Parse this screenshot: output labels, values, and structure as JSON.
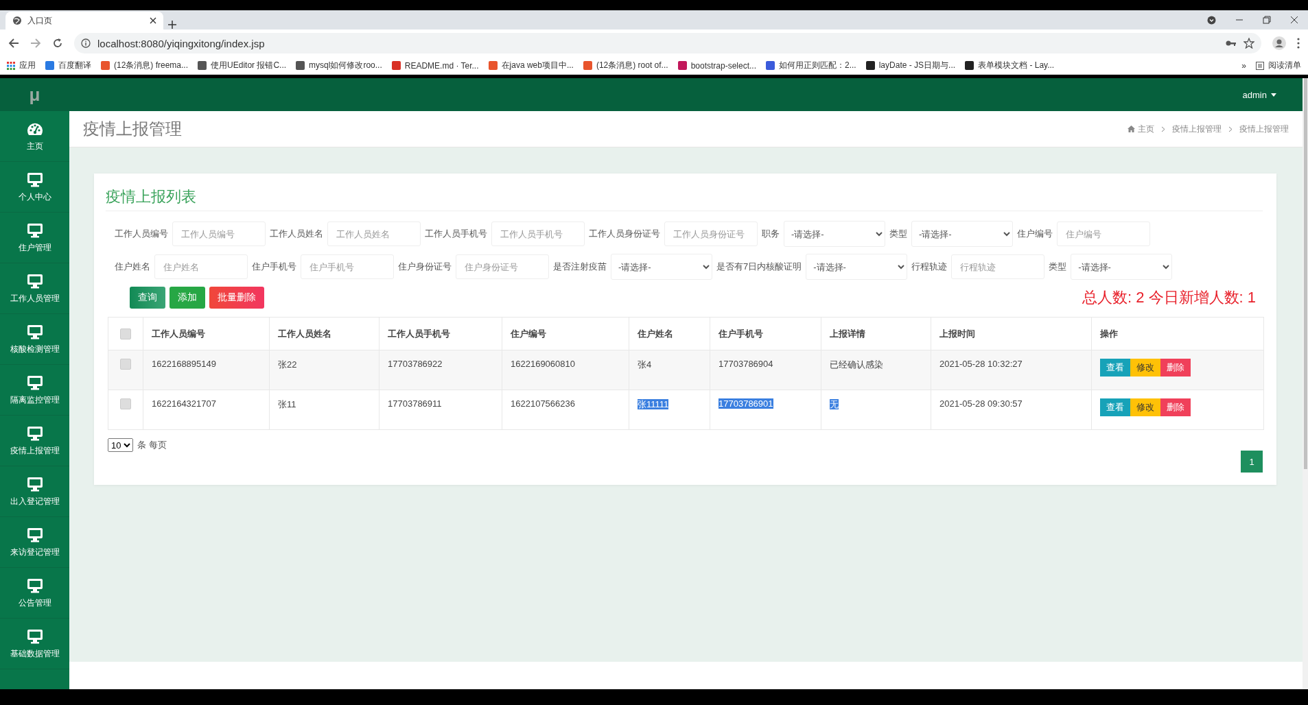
{
  "browser": {
    "tab_title": "入口页",
    "url": "localhost:8080/yiqingxitong/index.jsp",
    "apps_label": "应用",
    "bookmarks": [
      {
        "label": "百度翻译",
        "color": "#2a7ae2"
      },
      {
        "label": "(12条消息) freema...",
        "color": "#e8542c"
      },
      {
        "label": "使用UEditor 报错C...",
        "color": "#555555"
      },
      {
        "label": "mysql如何修改roo...",
        "color": "#555555"
      },
      {
        "label": "README.md · Ter...",
        "color": "#d93025"
      },
      {
        "label": "在java web项目中...",
        "color": "#e8542c"
      },
      {
        "label": "(12条消息) root of...",
        "color": "#e8542c"
      },
      {
        "label": "bootstrap-select...",
        "color": "#c2185b"
      },
      {
        "label": "如何用正则匹配：2...",
        "color": "#3b5bdb"
      },
      {
        "label": "layDate - JS日期与...",
        "color": "#222222"
      },
      {
        "label": "表单模块文档 - Lay...",
        "color": "#222222"
      }
    ],
    "more_label": "»",
    "reading_list": "阅读清单"
  },
  "app": {
    "logo": "μ",
    "user": "admin",
    "sidebar": [
      {
        "label": "主页",
        "kind": "dashboard"
      },
      {
        "label": "个人中心",
        "kind": "monitor"
      },
      {
        "label": "住户管理",
        "kind": "monitor"
      },
      {
        "label": "工作人员管理",
        "kind": "monitor"
      },
      {
        "label": "核酸检测管理",
        "kind": "monitor"
      },
      {
        "label": "隔离监控管理",
        "kind": "monitor"
      },
      {
        "label": "疫情上报管理",
        "kind": "monitor"
      },
      {
        "label": "出入登记管理",
        "kind": "monitor"
      },
      {
        "label": "来访登记管理",
        "kind": "monitor"
      },
      {
        "label": "公告管理",
        "kind": "monitor"
      },
      {
        "label": "基础数据管理",
        "kind": "monitor"
      }
    ],
    "page_title": "疫情上报管理",
    "breadcrumb": [
      "主页",
      "疫情上报管理",
      "疫情上报管理"
    ],
    "card_title": "疫情上报列表",
    "filters": [
      [
        {
          "label": "工作人员编号",
          "kind": "input",
          "placeholder": "工作人员编号"
        },
        {
          "label": "工作人员姓名",
          "kind": "input",
          "placeholder": "工作人员姓名"
        },
        {
          "label": "工作人员手机号",
          "kind": "input",
          "placeholder": "工作人员手机号"
        },
        {
          "label": "工作人员身份证号",
          "kind": "input",
          "placeholder": "工作人员身份证号"
        },
        {
          "label": "职务",
          "kind": "select",
          "value": "-请选择-"
        },
        {
          "label": "类型",
          "kind": "select",
          "value": "-请选择-"
        },
        {
          "label": "住户编号",
          "kind": "input",
          "placeholder": "住户编号"
        }
      ],
      [
        {
          "label": "住户姓名",
          "kind": "input",
          "placeholder": "住户姓名"
        },
        {
          "label": "住户手机号",
          "kind": "input",
          "placeholder": "住户手机号"
        },
        {
          "label": "住户身份证号",
          "kind": "input",
          "placeholder": "住户身份证号"
        },
        {
          "label": "是否注射疫苗",
          "kind": "select",
          "value": "-请选择-"
        },
        {
          "label": "是否有7日内核酸证明",
          "kind": "select",
          "value": "-请选择-"
        },
        {
          "label": "行程轨迹",
          "kind": "input",
          "placeholder": "行程轨迹"
        },
        {
          "label": "类型",
          "kind": "select",
          "value": "-请选择-"
        }
      ]
    ],
    "buttons": [
      {
        "label": "查询",
        "kind": "query"
      },
      {
        "label": "添加",
        "kind": "add"
      },
      {
        "label": "批量删除",
        "kind": "delete"
      }
    ],
    "stats": "总人数: 2 今日新增人数: 1",
    "table": {
      "all_checked": false,
      "columns": [
        "工作人员编号",
        "工作人员姓名",
        "工作人员手机号",
        "住户编号",
        "住户姓名",
        "住户手机号",
        "上报详情",
        "上报时间",
        "操作"
      ],
      "rows": [
        {
          "checked": false,
          "cells": [
            {
              "text": "1622168895149",
              "highlighted": false
            },
            {
              "text": "张22",
              "highlighted": false
            },
            {
              "text": "17703786922",
              "highlighted": false
            },
            {
              "text": "1622169060810",
              "highlighted": false
            },
            {
              "text": "张4",
              "highlighted": false
            },
            {
              "text": "17703786904",
              "highlighted": false
            },
            {
              "text": "已经确认感染",
              "highlighted": false
            },
            {
              "text": "2021-05-28 10:32:27",
              "highlighted": false
            }
          ],
          "actions": [
            {
              "label": "查看",
              "kind": "view"
            },
            {
              "label": "修改",
              "kind": "edit"
            },
            {
              "label": "删除",
              "kind": "delete"
            }
          ]
        },
        {
          "checked": false,
          "cells": [
            {
              "text": "1622164321707",
              "highlighted": false
            },
            {
              "text": "张11",
              "highlighted": false
            },
            {
              "text": "17703786911",
              "highlighted": false
            },
            {
              "text": "1622107566236",
              "highlighted": false
            },
            {
              "text": "张11111",
              "highlighted": true
            },
            {
              "text": "17703786901",
              "highlighted": true
            },
            {
              "text": "无",
              "highlighted": true
            },
            {
              "text": "2021-05-28 09:30:57",
              "highlighted": false
            }
          ],
          "actions": [
            {
              "label": "查看",
              "kind": "view"
            },
            {
              "label": "修改",
              "kind": "edit"
            },
            {
              "label": "删除",
              "kind": "delete"
            }
          ]
        }
      ]
    },
    "page_size": "10",
    "page_size_label": "条 每页",
    "pages": [
      {
        "label": "1",
        "selected": true
      }
    ]
  }
}
